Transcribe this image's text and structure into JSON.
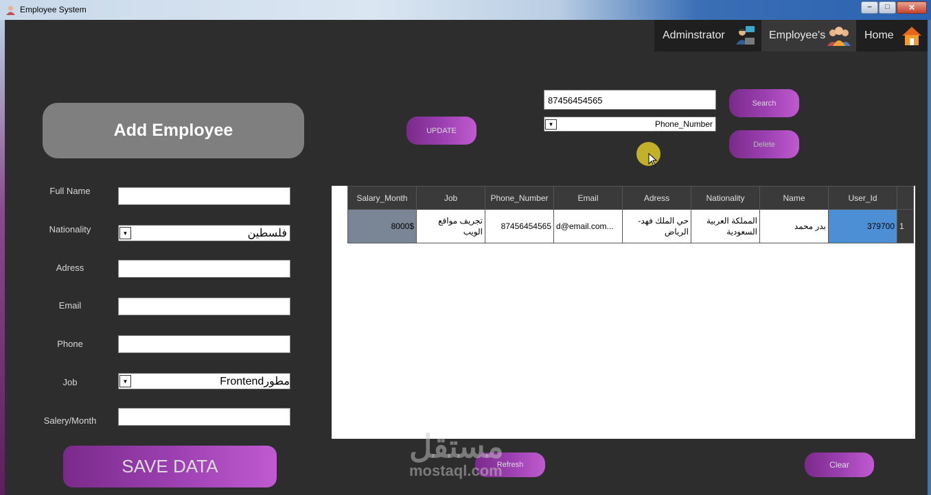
{
  "window": {
    "title": "Employee System"
  },
  "nav": {
    "admin_label": "Adminstrator",
    "employees_label": "Employee's",
    "home_label": "Home"
  },
  "form": {
    "header": "Add Employee",
    "labels": {
      "full_name": "Full Name",
      "nationality": "Nationality",
      "adress": "Adress",
      "email": "Email",
      "phone": "Phone",
      "job": "Job",
      "salary": "Salery/Month"
    },
    "values": {
      "full_name": "",
      "nationality": "فلسطين",
      "adress": "",
      "email": "",
      "phone": "",
      "job": "مطورFrontend",
      "salary": ""
    },
    "save_label": "SAVE DATA"
  },
  "toolbar": {
    "update_label": "UPDATE",
    "search_value": "87456454565",
    "search_field": "Phone_Number",
    "search_label": "Search",
    "delete_label": "Delete",
    "refresh_label": "Refresh",
    "clear_label": "Clear"
  },
  "grid": {
    "columns": [
      "Salary_Month",
      "Job",
      "Phone_Number",
      "Email",
      "Adress",
      "Nationality",
      "Name",
      "User_Id"
    ],
    "rows": [
      {
        "index": "1",
        "salary": "8000$",
        "job": "تجريف مواقع الويب",
        "phone": "87456454565",
        "email": "d@email.com...",
        "adress": "حي الملك فهد-الرياض",
        "nationality": "المملكة العربية السعودية",
        "name": "بدر محمد",
        "user_id": "379700"
      }
    ]
  },
  "watermark": {
    "ar": "مستقل",
    "en": "mostaql.com"
  },
  "colors": {
    "accent_purple": "#9b3fb0",
    "selected_cell": "#4d8fd5",
    "background": "#2d2d2d"
  }
}
